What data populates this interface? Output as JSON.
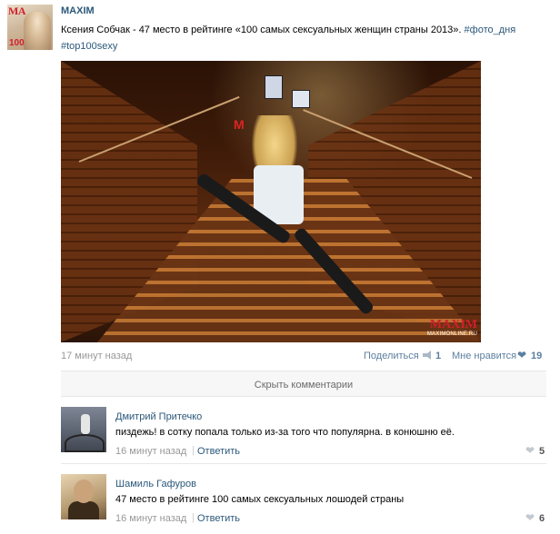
{
  "post": {
    "author": "MAXIM",
    "avatar_logo_text": "MA",
    "avatar_number": "100",
    "text": "Ксения Собчак - 47 место в рейтинге «100 самых сексуальных женщин страны 2013».",
    "hashtags": [
      "#фото_дня",
      "#top100sexy"
    ],
    "photo": {
      "watermark_brand": "MAXIM",
      "watermark_site": "MAXIMONLINE.RU",
      "metro_sign": "M"
    },
    "time": "17 минут назад",
    "share_label": "Поделиться",
    "share_count": "1",
    "like_label": "Мне нравится",
    "like_count": "19"
  },
  "comments_toggle_label": "Скрыть комментарии",
  "comments": [
    {
      "author": "Дмитрий Притечко",
      "text": "пиздежь! в сотку попала только из-за того что популярна. в конюшню её.",
      "time": "16 минут назад",
      "separator": "|",
      "reply_label": "Ответить",
      "likes": "5"
    },
    {
      "author": "Шамиль Гафуров",
      "text": "47 место в рейтинге 100 самых сексуальных лошодей страны",
      "time": "16 минут назад",
      "separator": "|",
      "reply_label": "Ответить",
      "likes": "6"
    }
  ],
  "colors": {
    "link": "#2b587a",
    "meta_gray": "#999999",
    "accent_red": "#d31f2b"
  }
}
